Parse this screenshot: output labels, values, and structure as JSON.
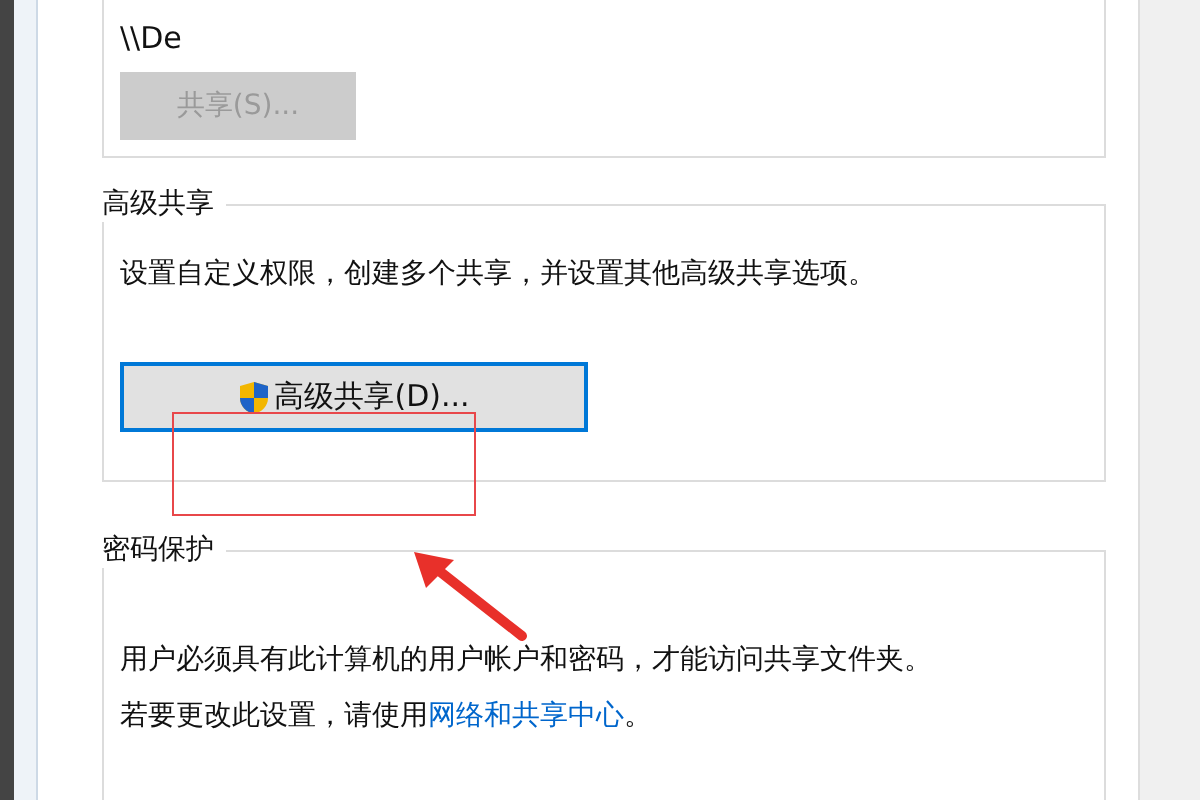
{
  "network_path": {
    "text": "\\\\De"
  },
  "share_button": {
    "label": "共享(S)...",
    "disabled": true
  },
  "advanced_sharing": {
    "title": "高级共享",
    "description": "设置自定义权限，创建多个共享，并设置其他高级共享选项。",
    "button": {
      "label": "高级共享(D)...",
      "focused": true
    }
  },
  "password_protection": {
    "title": "密码保护",
    "description": "用户必须具有此计算机的用户帐户和密码，才能访问共享文件夹。",
    "hint": "若要更改此设置，请使用",
    "link": "网络和共享中心",
    "hint_end": "。"
  }
}
